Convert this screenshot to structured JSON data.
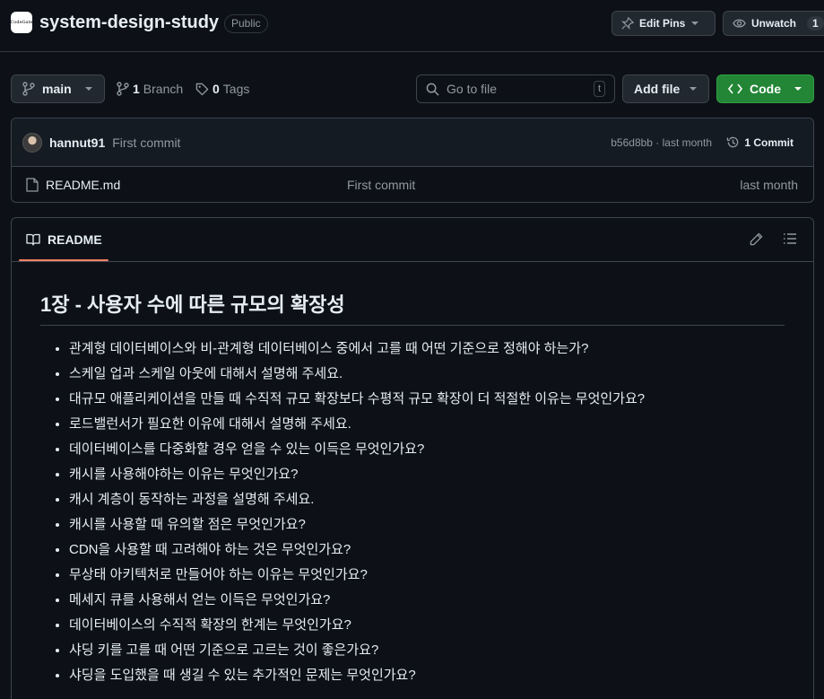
{
  "repo": {
    "name": "system-design-study",
    "visibility": "Public",
    "logo_text": "CodeGate"
  },
  "header_actions": {
    "edit_pins": "Edit Pins",
    "unwatch": "Unwatch",
    "watch_count": "1"
  },
  "toolbar": {
    "branch": "main",
    "branches_count": "1",
    "branches_label": "Branch",
    "tags_count": "0",
    "tags_label": "Tags",
    "goto_placeholder": "Go to file",
    "goto_shortcut": "t",
    "add_file": "Add file",
    "code": "Code"
  },
  "latest_commit": {
    "user": "hannut91",
    "message": "First commit",
    "hash": "b56d8bb · last month",
    "count": "1 Commit"
  },
  "files": [
    {
      "name": "README.md",
      "message": "First commit",
      "time": "last month"
    }
  ],
  "readme": {
    "tab": "README",
    "title": "1장 - 사용자 수에 따른 규모의 확장성",
    "items": [
      "관계형 데이터베이스와 비-관계형 데이터베이스 중에서 고를 때 어떤 기준으로 정해야 하는가?",
      "스케일 업과 스케일 아웃에 대해서 설명해 주세요.",
      "대규모 애플리케이션을 만들 때 수직적 규모 확장보다 수평적 규모 확장이 더 적절한 이유는 무엇인가요?",
      "로드밸런서가 필요한 이유에 대해서 설명해 주세요.",
      "데이터베이스를 다중화할 경우 얻을 수 있는 이득은 무엇인가요?",
      "캐시를 사용해야하는 이유는 무엇인가요?",
      "캐시 계층이 동작하는 과정을 설명해 주세요.",
      "캐시를 사용할 때 유의할 점은 무엇인가요?",
      "CDN을 사용할 때 고려해야 하는 것은 무엇인가요?",
      "무상태 아키텍처로 만들어야 하는 이유는 무엇인가요?",
      "메세지 큐를 사용해서 얻는 이득은 무엇인가요?",
      "데이터베이스의 수직적 확장의 한계는 무엇인가요?",
      "샤딩 키를 고를 때 어떤 기준으로 고르는 것이 좋은가요?",
      "샤딩을 도입했을 때 생길 수 있는 추가적인 문제는 무엇인가요?"
    ]
  },
  "colors": {
    "bg": "#0d1117",
    "border": "#3d444d",
    "accent_green": "#238636",
    "tab_underline": "#f78166",
    "muted": "#9198a1"
  }
}
